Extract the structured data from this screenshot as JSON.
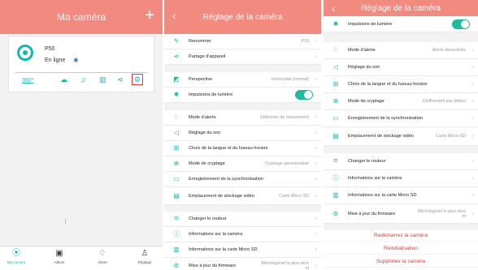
{
  "screen1": {
    "title": "Ma caméra",
    "add_icon": "plus-icon",
    "camera": {
      "name": "P50",
      "status": "En ligne",
      "action_360": "360°"
    },
    "tabs": [
      {
        "label": "Ma caméra",
        "icon": "home-camera-icon"
      },
      {
        "label": "Album",
        "icon": "album-icon"
      },
      {
        "label": "Alerte",
        "icon": "bell-icon"
      },
      {
        "label": "Réglage",
        "icon": "user-icon"
      }
    ]
  },
  "screen2": {
    "title": "Réglage de la caméra",
    "rows": [
      {
        "label": "Renommer",
        "value": "P20"
      },
      {
        "label": "Partage d'appareil",
        "value": ""
      },
      {
        "label": "Perspective",
        "value": "Horizontal (normal)"
      },
      {
        "label": "Impulsions de lumière",
        "value": ""
      },
      {
        "label": "Mode d'alerte",
        "value": "Détection de mouvement"
      },
      {
        "label": "Réglage du son",
        "value": ""
      },
      {
        "label": "Choix de la langue et du fuseau horaire",
        "value": ""
      },
      {
        "label": "Mode de cryptage",
        "value": "Cryptage personnalisé"
      },
      {
        "label": "Enregistrement de la synchronisation",
        "value": ""
      },
      {
        "label": "Emplacement de stockage vidéo",
        "value": "Carte Micro SD"
      },
      {
        "label": "Changer le routeur",
        "value": ""
      },
      {
        "label": "Informations sur la caméra",
        "value": ""
      },
      {
        "label": "Informations sur la carte Micro SD",
        "value": ""
      },
      {
        "label": "Mise à jour du firmware",
        "value": "Micrologiciel le plus réce",
        "value2": "nt"
      }
    ]
  },
  "screen3": {
    "title": "Réglage de la caméra",
    "rows": [
      {
        "label": "Impulsions de lumière",
        "value": ""
      },
      {
        "label": "Mode d'alerte",
        "value": "Alerte désactivée"
      },
      {
        "label": "Réglage du son",
        "value": ""
      },
      {
        "label": "Choix de la langue et du fuseau horaire",
        "value": ""
      },
      {
        "label": "Mode de cryptage",
        "value": "Chiffrement par défaut"
      },
      {
        "label": "Enregistrement de la synchronisation",
        "value": ""
      },
      {
        "label": "Emplacement de stockage vidéo",
        "value": "Carte Micro SD"
      },
      {
        "label": "Changer le routeur",
        "value": ""
      },
      {
        "label": "Informations sur la caméra",
        "value": ""
      },
      {
        "label": "Informations sur la carte Micro SD",
        "value": ""
      },
      {
        "label": "Mise à jour du firmware",
        "value": "Micrologiciel le plus réce",
        "value2": "nt"
      }
    ],
    "buttons": {
      "restart": "Redémarrez la caméra",
      "reset": "Réinitialisation",
      "delete": "Supprimer la caméra"
    }
  },
  "colors": {
    "header": "#f38a80",
    "accent": "#14b5b5",
    "toggle_on": "#1cbc9c",
    "danger": "#e53935"
  }
}
